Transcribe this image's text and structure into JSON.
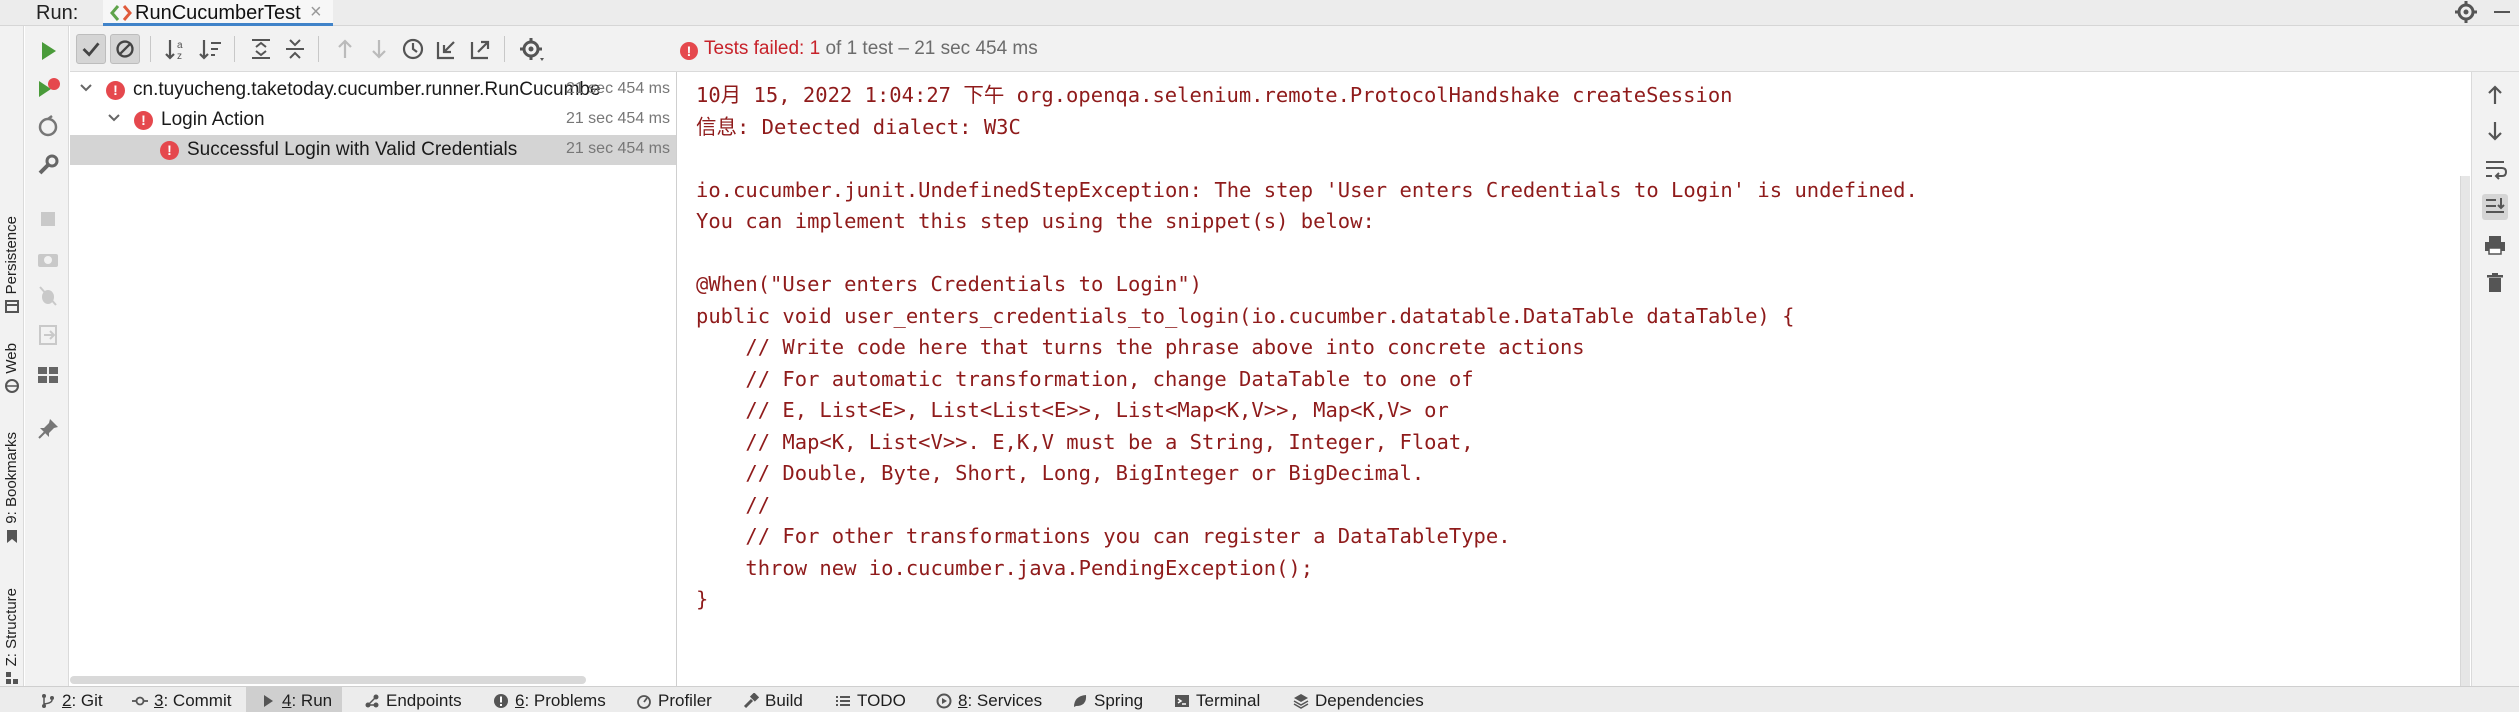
{
  "topbar": {
    "run_label": "Run:",
    "tab_title": "RunCucumberTest",
    "tab_close": "×"
  },
  "left_stripe": {
    "tabs": [
      {
        "label": "Persistence",
        "icon": "persistence-icon"
      },
      {
        "label": "Web",
        "icon": "web-icon"
      },
      {
        "label": "9: Bookmarks",
        "icon": "bookmark-icon"
      },
      {
        "label": "Z: Structure",
        "icon": "structure-icon"
      }
    ]
  },
  "status": {
    "prefix": "Tests failed: ",
    "failed": "1",
    "of_total": " of 1 test",
    "separator": " – ",
    "duration": "21 sec 454 ms"
  },
  "tree": {
    "rows": [
      {
        "name": "cn.tuyucheng.taketoday.cucumber.runner.RunCucumberTest",
        "time": "21 sec 454 ms"
      },
      {
        "name": "Login Action",
        "time": "21 sec 454 ms"
      },
      {
        "name": "Successful Login with Valid Credentials",
        "time": "21 sec 454 ms"
      }
    ]
  },
  "console": {
    "lines": [
      "10月 15, 2022 1:04:27 下午 org.openqa.selenium.remote.ProtocolHandshake createSession",
      "信息: Detected dialect: W3C",
      "",
      "io.cucumber.junit.UndefinedStepException: The step 'User enters Credentials to Login' is undefined.",
      "You can implement this step using the snippet(s) below:",
      "",
      "@When(\"User enters Credentials to Login\")",
      "public void user_enters_credentials_to_login(io.cucumber.datatable.DataTable dataTable) {",
      "    // Write code here that turns the phrase above into concrete actions",
      "    // For automatic transformation, change DataTable to one of",
      "    // E, List<E>, List<List<E>>, List<Map<K,V>>, Map<K,V> or",
      "    // Map<K, List<V>>. E,K,V must be a String, Integer, Float,",
      "    // Double, Byte, Short, Long, BigInteger or BigDecimal.",
      "    //",
      "    // For other transformations you can register a DataTableType.",
      "    throw new io.cucumber.java.PendingException();",
      "}"
    ]
  },
  "bottom_tabs": [
    {
      "num": "2",
      "label": ": Git",
      "icon": "git-branch-icon"
    },
    {
      "num": "3",
      "label": ": Commit",
      "icon": "commit-icon"
    },
    {
      "num": "4",
      "label": ": Run",
      "icon": "run-icon"
    },
    {
      "num": "",
      "label": "Endpoints",
      "icon": "endpoints-icon"
    },
    {
      "num": "6",
      "label": ": Problems",
      "icon": "problems-icon"
    },
    {
      "num": "",
      "label": "Profiler",
      "icon": "profiler-icon"
    },
    {
      "num": "",
      "label": "Build",
      "icon": "build-icon"
    },
    {
      "num": "",
      "label": "TODO",
      "icon": "todo-icon"
    },
    {
      "num": "8",
      "label": ": Services",
      "icon": "services-icon"
    },
    {
      "num": "",
      "label": "Spring",
      "icon": "spring-icon"
    },
    {
      "num": "",
      "label": "Terminal",
      "icon": "terminal-icon"
    },
    {
      "num": "",
      "label": "Dependencies",
      "icon": "dependencies-icon"
    }
  ],
  "colors": {
    "console_text": "#8f1b1b",
    "error": "#e5484d",
    "run_green": "#4a9b3a",
    "accent": "#4083c9"
  }
}
